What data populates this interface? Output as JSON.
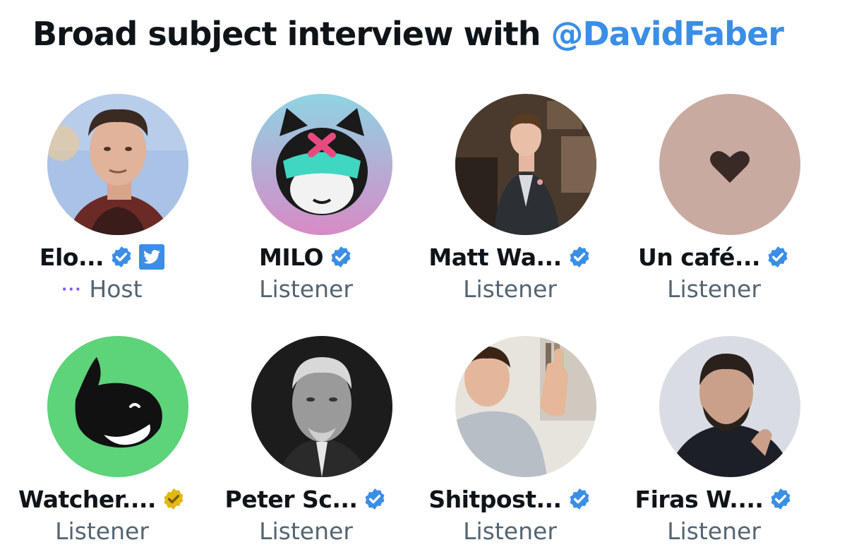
{
  "space": {
    "title_prefix": "Broad subject interview with ",
    "title_mention": "@DavidFaber"
  },
  "participants": [
    {
      "name": "Elo...",
      "role": "Host",
      "verified": "blue",
      "twitter_badge": true,
      "speaking_indicator": "···"
    },
    {
      "name": "MILO",
      "role": "Listener",
      "verified": "blue"
    },
    {
      "name": "Matt Wa...",
      "role": "Listener",
      "verified": "blue"
    },
    {
      "name": "Un café...",
      "role": "Listener",
      "verified": "blue"
    },
    {
      "name": "Watcher....",
      "role": "Listener",
      "verified": "gold"
    },
    {
      "name": "Peter Sc...",
      "role": "Listener",
      "verified": "blue"
    },
    {
      "name": "Shitpost...",
      "role": "Listener",
      "verified": "blue"
    },
    {
      "name": "Firas W....",
      "role": "Listener",
      "verified": "blue"
    }
  ],
  "colors": {
    "verified_blue": "#3a8ee6",
    "verified_gold": "#e2b719",
    "mention": "#3a8ee6",
    "host_dots": "#7856ff",
    "secondary_text": "#536471"
  },
  "icons": {
    "verified": "verified-checkmark-icon",
    "twitter": "twitter-bird-icon",
    "heart": "heart-icon",
    "whale": "whale-icon"
  }
}
